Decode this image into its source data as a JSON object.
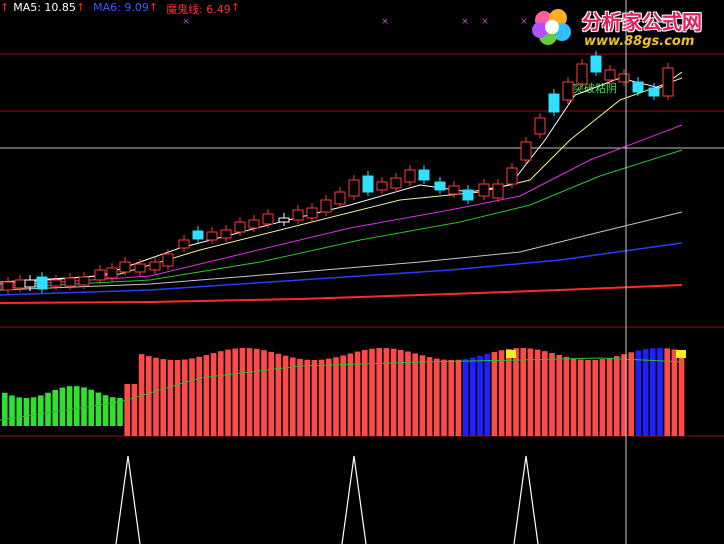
{
  "legend": {
    "ma5": "MA5: 10.85",
    "ma5_color": "#ffffff",
    "ma6": "MA6: 9.09",
    "ma6_color": "#3a5cff",
    "demon_line": "魔鬼线: 6.49",
    "demon_color": "#ff3030",
    "arrow": "↑"
  },
  "logo": {
    "title": "分析家公式网",
    "url": "www.88gs.com"
  },
  "signal_label": "突破粘阴",
  "colors": {
    "up": "#ff3a3a",
    "down": "#30e0ff",
    "bar_red": "#ff4a4a",
    "bar_green": "#30e030",
    "bar_blue": "#2020ff",
    "bar_yellow": "#f0f020",
    "grid": "#9a1010"
  }
}
